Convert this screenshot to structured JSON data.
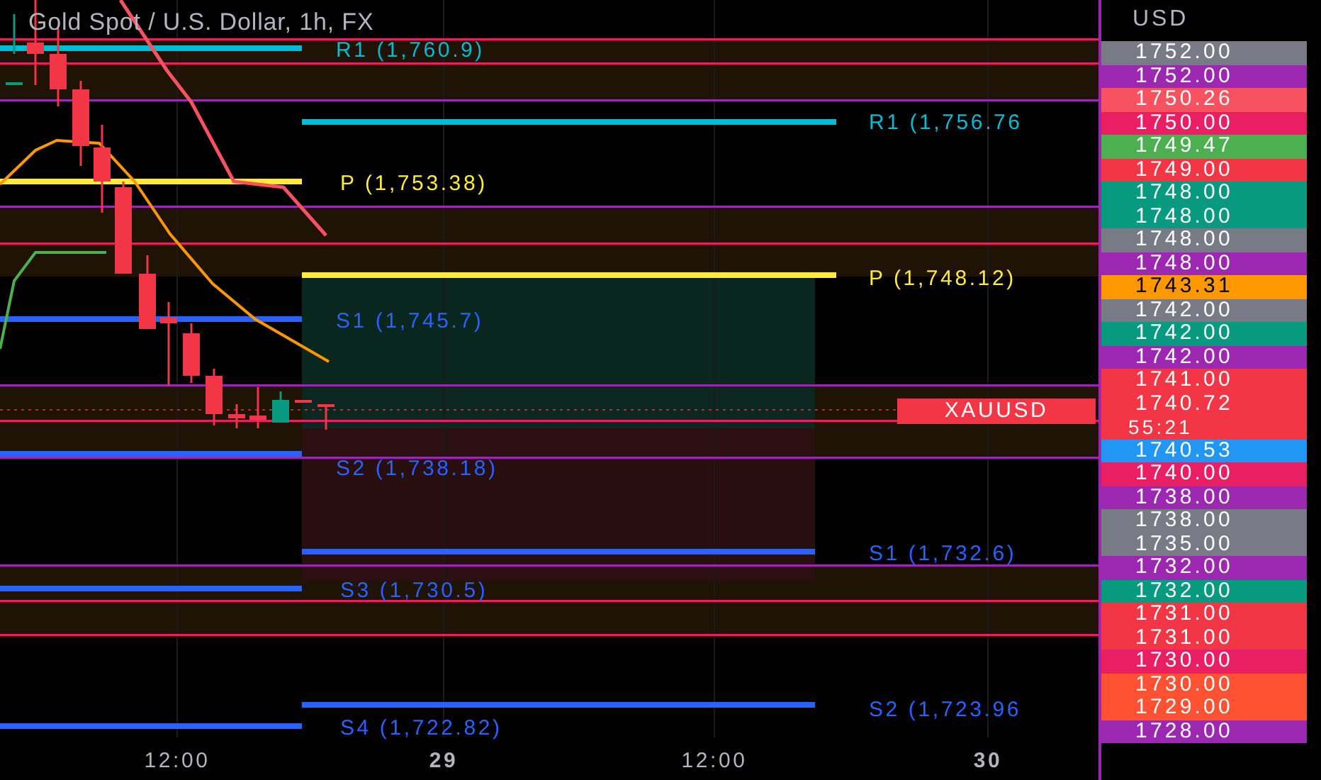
{
  "title": "Gold Spot / U.S. Dollar, 1h, FX",
  "pivot_labels": [
    {
      "text": "R1 (1,760.9)",
      "color": "#00bcd4"
    },
    {
      "text": "R1 (1,756.76",
      "color": "#00bcd4"
    },
    {
      "text": "P (1,753.38)",
      "color": "#ffeb3b"
    },
    {
      "text": "P (1,748.12)",
      "color": "#ffeb3b"
    },
    {
      "text": "S1 (1,745.7)",
      "color": "#2962ff"
    },
    {
      "text": "S2 (1,738.18)",
      "color": "#2962ff"
    },
    {
      "text": "S1 (1,732.6)",
      "color": "#2962ff"
    },
    {
      "text": "S3 (1,730.5)",
      "color": "#2962ff"
    },
    {
      "text": "S2 (1,723.96",
      "color": "#2962ff"
    },
    {
      "text": "S4 (1,722.82)",
      "color": "#2962ff"
    }
  ],
  "symbol_tag": "XAUUSD",
  "currency": "USD",
  "price_tags": [
    {
      "text": "1752.00",
      "color": "#787b86"
    },
    {
      "text": "1752.00",
      "color": "#9c27b0"
    },
    {
      "text": "1750.26",
      "color": "#f7525f"
    },
    {
      "text": "1750.00",
      "color": "#e91e63"
    },
    {
      "text": "1749.47",
      "color": "#4caf50"
    },
    {
      "text": "1749.00",
      "color": "#f23645"
    },
    {
      "text": "1748.00",
      "color": "#089981"
    },
    {
      "text": "1748.00",
      "color": "#089981"
    },
    {
      "text": "1748.00",
      "color": "#787b86"
    },
    {
      "text": "1748.00",
      "color": "#9c27b0"
    },
    {
      "text": "1743.31",
      "color": "#ff9800"
    },
    {
      "text": "1742.00",
      "color": "#787b86"
    },
    {
      "text": "1742.00",
      "color": "#089981"
    },
    {
      "text": "1742.00",
      "color": "#9c27b0"
    },
    {
      "text": "1741.00",
      "color": "#f23645"
    },
    {
      "text": "1740.72",
      "countdown": "55:21",
      "color": "#f23645"
    },
    {
      "text": "1740.53",
      "color": "#2196f3"
    },
    {
      "text": "1740.00",
      "color": "#e91e63"
    },
    {
      "text": "1738.00",
      "color": "#9c27b0"
    },
    {
      "text": "1738.00",
      "color": "#787b86"
    },
    {
      "text": "1735.00",
      "color": "#787b86"
    },
    {
      "text": "1732.00",
      "color": "#9c27b0"
    },
    {
      "text": "1732.00",
      "color": "#089981"
    },
    {
      "text": "1731.00",
      "color": "#f23645"
    },
    {
      "text": "1731.00",
      "color": "#f23645"
    },
    {
      "text": "1730.00",
      "color": "#e91e63"
    },
    {
      "text": "1730.00",
      "color": "#ff5232"
    },
    {
      "text": "1729.00",
      "color": "#ff5232"
    },
    {
      "text": "1728.00",
      "color": "#9c27b0"
    }
  ],
  "time_labels": [
    "12:00",
    "29",
    "12:00",
    "30"
  ]
}
